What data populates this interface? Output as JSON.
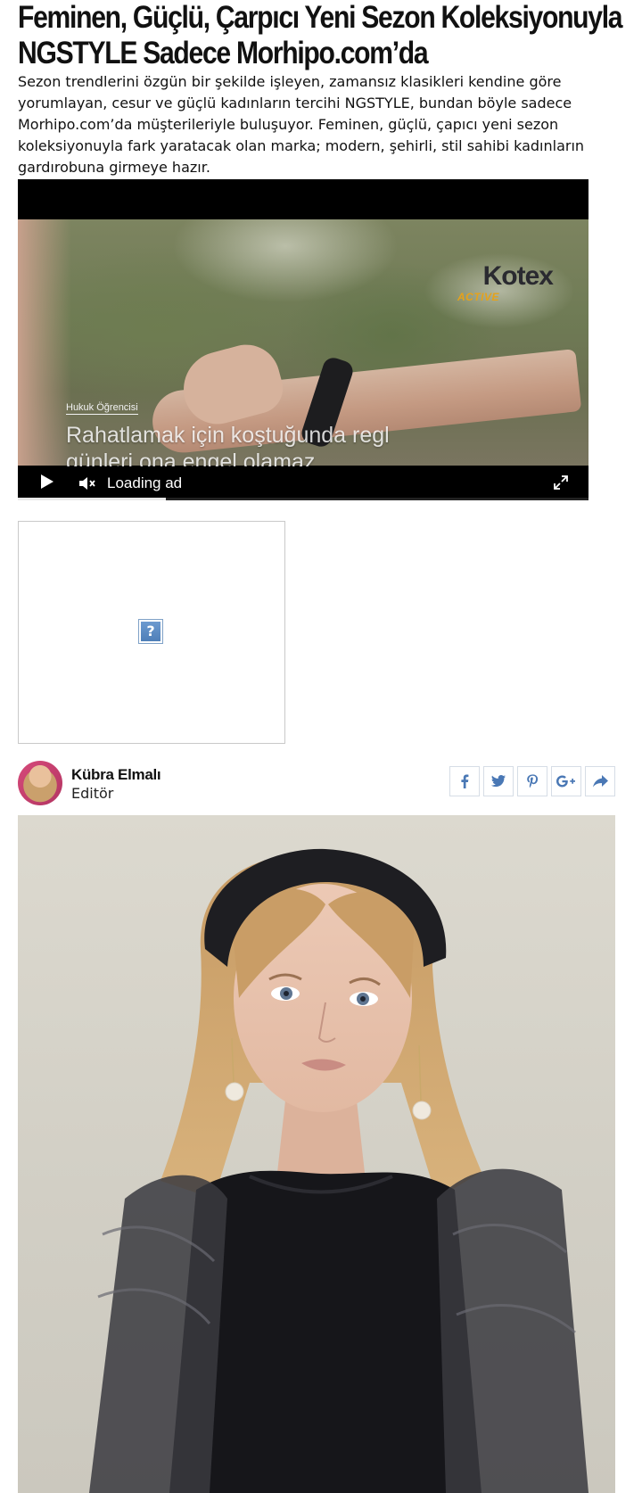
{
  "article": {
    "headline": "Feminen, Güçlü, Çarpıcı Yeni Sezon Koleksiyonuyla NGSTYLE Sadece Morhipo.com’da",
    "summary": "Sezon trendlerini özgün bir şekilde işleyen, zamansız klasikleri kendine göre yorumlayan, cesur ve güçlü kadınların tercihi NGSTYLE, bundan böyle sadece Morhipo.com’da müşterileriyle buluşuyor. Feminen, güçlü, çapıcı yeni sezon koleksiyonuyla fark yaratacak olan marka; modern, şehirli, stil sahibi kadınların gardırobuna girmeye hazır."
  },
  "video_ad": {
    "brand_logo": "Kotex",
    "brand_sub": "ACTIVE",
    "caption_tag": "Hukuk Öğrencisi",
    "caption_text": "Rahatlamak için koştuğunda regl günleri ona engel olamaz.",
    "status_label": "Loading ad",
    "progress": 0.26,
    "icons": {
      "play": "play-icon",
      "mute": "mute-icon",
      "fullscreen": "fullscreen-icon"
    }
  },
  "ad_placeholder": {
    "icon": "broken-image-question-icon",
    "glyph": "?"
  },
  "author": {
    "name": "Kübra Elmalı",
    "role": "Editör",
    "avatar": "author-avatar"
  },
  "share": {
    "buttons": [
      "facebook-icon",
      "twitter-icon",
      "pinterest-icon",
      "google-plus-icon",
      "share-icon"
    ],
    "icon_color": "#4a78b5"
  },
  "hero_image": {
    "subject": "model-photo"
  }
}
